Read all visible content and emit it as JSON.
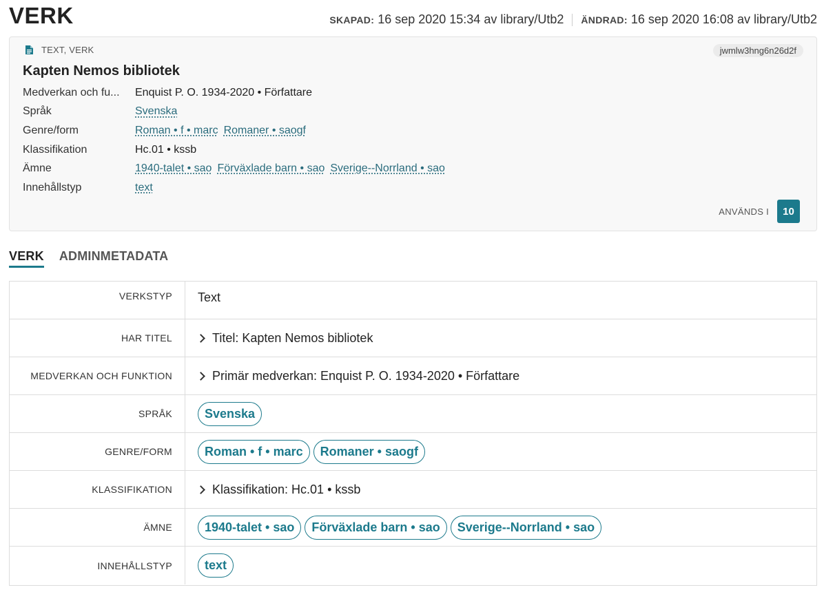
{
  "header": {
    "title": "VERK",
    "created_label": "SKAPAD:",
    "created_value": "16 sep 2020 15:34 av library/Utb2",
    "modified_label": "ÄNDRAD:",
    "modified_value": "16 sep 2020 16:08 av library/Utb2"
  },
  "card": {
    "type_label": "TEXT, VERK",
    "id": "jwmlw3hng6n26d2f",
    "title": "Kapten Nemos bibliotek",
    "props": {
      "contribution_label": "Medverkan och fu...",
      "contribution_value": "Enquist P. O. 1934-2020 • Författare",
      "language_label": "Språk",
      "language_links": [
        "Svenska"
      ],
      "genre_label": "Genre/form",
      "genre_links": [
        "Roman • f • marc",
        "Romaner • saogf"
      ],
      "classification_label": "Klassifikation",
      "classification_value": "Hc.01 • kssb",
      "subject_label": "Ämne",
      "subject_links": [
        "1940-talet • sao",
        "Förväxlade barn • sao",
        "Sverige--Norrland • sao"
      ],
      "content_type_label": "Innehållstyp",
      "content_type_links": [
        "text"
      ]
    },
    "used_in_label": "ANVÄNDS I",
    "used_in_count": "10"
  },
  "tabs": [
    {
      "label": "VERK",
      "active": true
    },
    {
      "label": "ADMINMETADATA",
      "active": false
    }
  ],
  "fields": {
    "verkstyp_label": "VERKSTYP",
    "verkstyp_value": "Text",
    "har_titel_label": "HAR TITEL",
    "har_titel_value": "Titel: Kapten Nemos bibliotek",
    "medverkan_label": "MEDVERKAN OCH FUNKTION",
    "medverkan_value": "Primär medverkan: Enquist P. O. 1934-2020 • Författare",
    "sprak_label": "SPRÅK",
    "sprak_chips": [
      "Svenska"
    ],
    "genre_label": "GENRE/FORM",
    "genre_chips": [
      "Roman • f • marc",
      "Romaner • saogf"
    ],
    "klassifikation_label": "KLASSIFIKATION",
    "klassifikation_value": "Klassifikation: Hc.01 • kssb",
    "amne_label": "ÄMNE",
    "amne_chips": [
      "1940-talet • sao",
      "Förväxlade barn • sao",
      "Sverige--Norrland • sao"
    ],
    "innehallstyp_label": "INNEHÅLLSTYP",
    "innehallstyp_chips": [
      "text"
    ]
  },
  "colors": {
    "accent": "#1c7a8c",
    "link": "#2a6c7d"
  },
  "icons": {
    "card_type": "document-icon",
    "expand": "chevron-right-icon"
  }
}
